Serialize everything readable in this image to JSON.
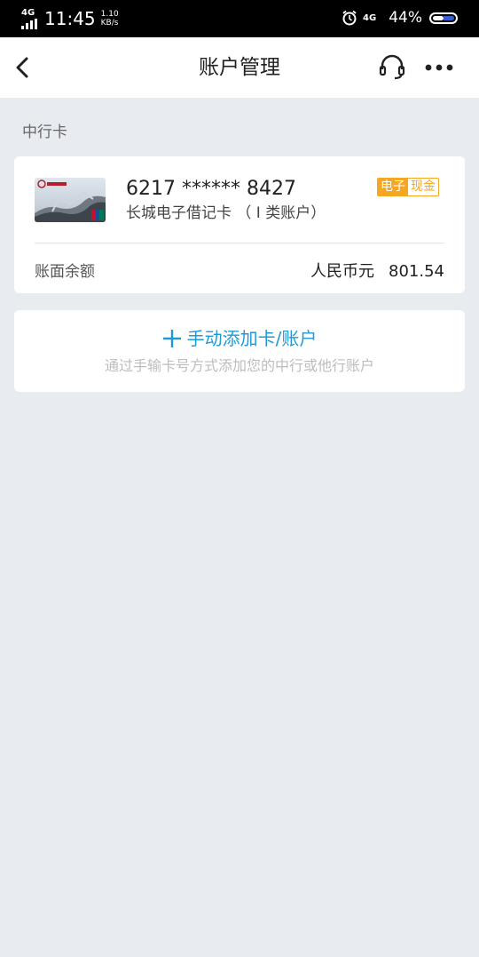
{
  "status_bar": {
    "network_left": "4G",
    "time": "11:45",
    "speed_value": "1.10",
    "speed_unit": "KB/s",
    "network_right": "4G",
    "battery": "44%"
  },
  "nav": {
    "title": "账户管理"
  },
  "section": {
    "label": "中行卡"
  },
  "card": {
    "number": "6217 ****** 8427",
    "type": "长城电子借记卡 （ Ⅰ 类账户）",
    "badge_left": "电子",
    "badge_right": "现金",
    "balance_label": "账面余额",
    "currency": "人民币元",
    "amount": "801.54"
  },
  "add": {
    "label": "手动添加卡/账户",
    "hint": "通过手输卡号方式添加您的中行或他行账户"
  },
  "colors": {
    "accent": "#1f9ad6",
    "badge": "#f5a623",
    "background": "#e8ebf0"
  },
  "icons": [
    "back-icon",
    "headset-icon",
    "more-icon",
    "plus-icon",
    "alarm-icon",
    "battery-icon"
  ]
}
